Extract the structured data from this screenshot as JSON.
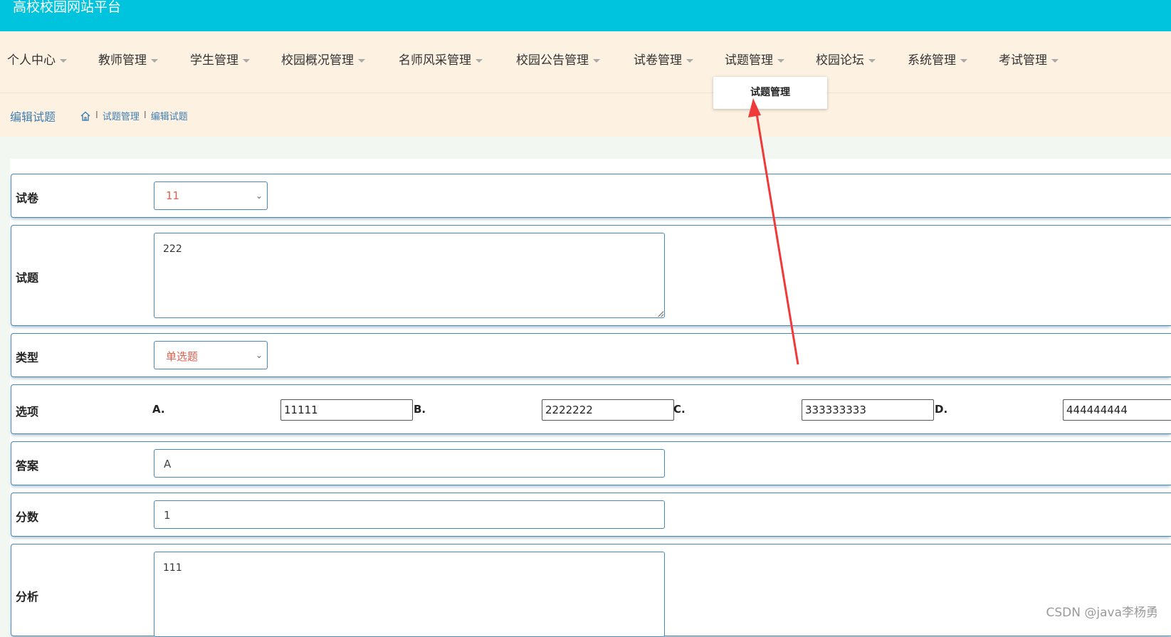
{
  "app": {
    "title": "高校校园网站平台"
  },
  "nav": {
    "items": [
      {
        "label": "个人中心"
      },
      {
        "label": "教师管理"
      },
      {
        "label": "学生管理"
      },
      {
        "label": "校园概况管理"
      },
      {
        "label": "名师风采管理"
      },
      {
        "label": "校园公告管理"
      },
      {
        "label": "试卷管理"
      },
      {
        "label": "试题管理"
      },
      {
        "label": "校园论坛"
      },
      {
        "label": "系统管理"
      },
      {
        "label": "考试管理"
      }
    ],
    "dropdown_item": "试题管理"
  },
  "page": {
    "title": "编辑试题",
    "breadcrumb": [
      "试题管理",
      "编辑试题"
    ],
    "breadcrumb_sep": "I"
  },
  "form": {
    "paper": {
      "label": "试卷",
      "value": "11"
    },
    "question": {
      "label": "试题",
      "value": "222"
    },
    "type": {
      "label": "类型",
      "value": "单选题"
    },
    "options": {
      "label": "选项",
      "items": [
        {
          "letter": "A.",
          "value": "11111"
        },
        {
          "letter": "B.",
          "value": "2222222"
        },
        {
          "letter": "C.",
          "value": "333333333"
        },
        {
          "letter": "D.",
          "value": "444444444"
        }
      ]
    },
    "answer": {
      "label": "答案",
      "value": "A"
    },
    "score": {
      "label": "分数",
      "value": "1"
    },
    "analysis": {
      "label": "分析",
      "value": "111"
    }
  },
  "watermark": "CSDN @java李杨勇",
  "colors": {
    "topbar": "#00c4de",
    "navbar": "#fdf1e2",
    "accent": "#3f7fb3",
    "annotation": "#f03a3a"
  }
}
